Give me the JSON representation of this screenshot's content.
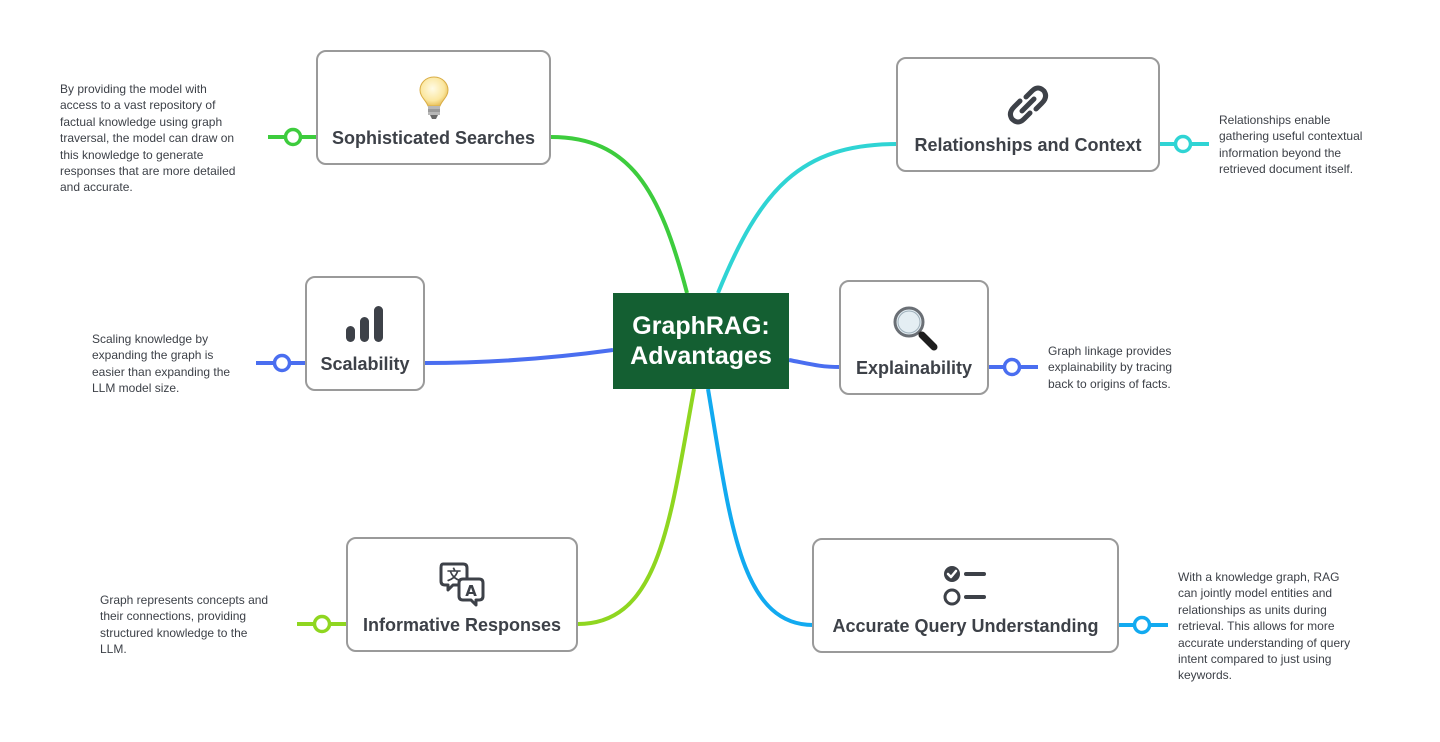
{
  "central_topic": {
    "line1": "GraphRAG:",
    "line2": "Advantages",
    "color": "#145f32"
  },
  "topics": [
    {
      "id": "sophisticated-searches",
      "label": "Sophisticated Searches",
      "icon": "lightbulb-icon",
      "branch_color": "#3dcc3d",
      "side": "left",
      "note": [
        "By providing the model with",
        "access to a vast repository of",
        "factual knowledge using graph",
        "traversal, the model can draw on",
        "this knowledge to generate",
        "responses that are more detailed",
        "and accurate."
      ]
    },
    {
      "id": "scalability",
      "label": "Scalability",
      "icon": "bar-chart-icon",
      "branch_color": "#4a6ef0",
      "side": "left",
      "note": [
        "Scaling knowledge by",
        "expanding the graph is",
        "easier than expanding the",
        "LLM model size."
      ]
    },
    {
      "id": "informative-responses",
      "label": "Informative Responses",
      "icon": "translate-icon",
      "branch_color": "#8fd620",
      "side": "left",
      "note": [
        "Graph represents concepts and",
        "their connections, providing",
        "structured knowledge to the",
        "LLM."
      ]
    },
    {
      "id": "relationships-and-context",
      "label": "Relationships and Context",
      "icon": "link-icon",
      "branch_color": "#2fd4d4",
      "side": "right",
      "note": [
        "Relationships enable",
        "gathering useful contextual",
        "information beyond the",
        "retrieved document itself."
      ]
    },
    {
      "id": "explainability",
      "label": "Explainability",
      "icon": "magnifier-icon",
      "branch_color": "#4a6ef0",
      "side": "right",
      "note": [
        "Graph linkage provides",
        "explainability by tracing",
        "back to origins of facts."
      ]
    },
    {
      "id": "accurate-query-understanding",
      "label": "Accurate Query Understanding",
      "icon": "checklist-icon",
      "branch_color": "#12aaf0",
      "side": "right",
      "note": [
        "With a knowledge graph, RAG",
        "can jointly model entities and",
        "relationships as units during",
        "retrieval. This allows for more",
        "accurate understanding of query",
        "intent compared to just using",
        "keywords."
      ]
    }
  ]
}
